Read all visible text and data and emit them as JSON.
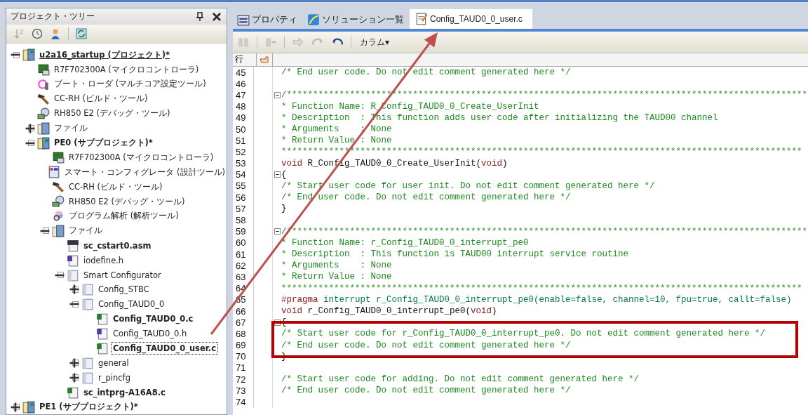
{
  "project_tree": {
    "title": "プロジェクト・ツリー",
    "items": [
      {
        "label": "u2a16_startup (プロジェクト)*",
        "kind": "project",
        "bold": true,
        "active": true,
        "selected": false,
        "expanded": true,
        "children": [
          {
            "label": "R7F702300A (マイクロコントローラ)",
            "kind": "chip",
            "bold": false,
            "selected": false
          },
          {
            "label": "ブート・ローダ (マルチコア設定ツール)",
            "kind": "boot",
            "bold": false,
            "selected": false
          },
          {
            "label": "CC-RH (ビルド・ツール)",
            "kind": "hammer",
            "bold": false,
            "selected": false
          },
          {
            "label": "RH850 E2 (デバッグ・ツール)",
            "kind": "debugger",
            "bold": false,
            "selected": false
          },
          {
            "label": "ファイル",
            "kind": "files",
            "bold": false,
            "selected": false,
            "expanded": false
          },
          {
            "label": "PE0 (サブプロジェクト)*",
            "kind": "project",
            "bold": true,
            "active": false,
            "selected": false,
            "expanded": true,
            "children": [
              {
                "label": "R7F702300A (マイクロコントローラ)",
                "kind": "chip",
                "bold": false,
                "selected": false
              },
              {
                "label": "スマート・コンフィグレータ (設計ツール)",
                "kind": "configurator",
                "bold": false,
                "selected": false
              },
              {
                "label": "CC-RH (ビルド・ツール)",
                "kind": "hammer",
                "bold": false,
                "selected": false
              },
              {
                "label": "RH850 E2 (デバッグ・ツール)",
                "kind": "debugger",
                "bold": false,
                "selected": false
              },
              {
                "label": "プログラム解析 (解析ツール)",
                "kind": "analyzer",
                "bold": false,
                "selected": false
              },
              {
                "label": "ファイル",
                "kind": "files",
                "bold": false,
                "selected": false,
                "expanded": true,
                "children": [
                  {
                    "label": "sc_cstart0.asm",
                    "kind": "asm",
                    "bold": true,
                    "selected": false
                  },
                  {
                    "label": "iodefine.h",
                    "kind": "h",
                    "bold": false,
                    "selected": false
                  },
                  {
                    "label": "Smart Configurator",
                    "kind": "folder",
                    "bold": false,
                    "selected": false,
                    "expanded": true,
                    "children": [
                      {
                        "label": "Config_STBC",
                        "kind": "folder",
                        "bold": false,
                        "selected": false,
                        "expanded": false
                      },
                      {
                        "label": "Config_TAUD0_0",
                        "kind": "folder",
                        "bold": false,
                        "selected": false,
                        "expanded": true,
                        "children": [
                          {
                            "label": "Config_TAUD0_0.c",
                            "kind": "c",
                            "bold": true,
                            "selected": false
                          },
                          {
                            "label": "Config_TAUD0_0.h",
                            "kind": "h",
                            "bold": false,
                            "selected": false
                          },
                          {
                            "label": "Config_TAUD0_0_user.c",
                            "kind": "c",
                            "bold": true,
                            "selected": true
                          }
                        ]
                      },
                      {
                        "label": "general",
                        "kind": "folder",
                        "bold": false,
                        "selected": false,
                        "expanded": false
                      },
                      {
                        "label": "r_pincfg",
                        "kind": "folder",
                        "bold": false,
                        "selected": false,
                        "expanded": false
                      }
                    ]
                  },
                  {
                    "label": "sc_intprg-A16A8.c",
                    "kind": "c",
                    "bold": true,
                    "selected": false
                  }
                ]
              }
            ]
          }
        ]
      },
      {
        "label": "PE1 (サブプロジェクト)*",
        "kind": "project",
        "bold": true,
        "active": false,
        "selected": false,
        "expanded": false
      }
    ]
  },
  "tabs": [
    {
      "label": "プロパティ",
      "kind": "properties",
      "selected": false
    },
    {
      "label": "ソリューション一覧",
      "kind": "solution",
      "selected": false
    },
    {
      "label": "Config_TAUD0_0_user.c",
      "kind": "document",
      "selected": true
    }
  ],
  "editor_toolbar": {
    "column_menu": "カラム▾"
  },
  "editor": {
    "line_header": "行",
    "lines": [
      {
        "number": "45",
        "fold": false,
        "segments": [
          {
            "kind": "comment",
            "text": "/* End user code. Do not edit comment generated here */"
          }
        ]
      },
      {
        "number": "46",
        "fold": false
      },
      {
        "number": "47",
        "fold": true,
        "segments": [
          {
            "kind": "comment",
            "text": "/***************************************************************************************************"
          }
        ]
      },
      {
        "number": "48",
        "fold": false,
        "segments": [
          {
            "kind": "comment",
            "text": "* Function Name: R_Config_TAUD0_0_Create_UserInit"
          }
        ]
      },
      {
        "number": "49",
        "fold": false,
        "segments": [
          {
            "kind": "comment",
            "text": "* Description  : This function adds user code after initializing the TAUD00 channel"
          }
        ]
      },
      {
        "number": "50",
        "fold": false,
        "segments": [
          {
            "kind": "comment",
            "text": "* Arguments    : None"
          }
        ]
      },
      {
        "number": "51",
        "fold": false,
        "segments": [
          {
            "kind": "comment",
            "text": "* Return Value : None"
          }
        ]
      },
      {
        "number": "52",
        "fold": false,
        "segments": [
          {
            "kind": "comment",
            "text": "***************************************************************************************************"
          }
        ]
      },
      {
        "number": "53",
        "fold": false,
        "segments": [
          {
            "kind": "keyword",
            "text": "void"
          },
          {
            "kind": "plain",
            "text": " R_Config_TAUD0_0_Create_UserInit("
          },
          {
            "kind": "keyword",
            "text": "void"
          },
          {
            "kind": "plain",
            "text": ")"
          }
        ]
      },
      {
        "number": "54",
        "fold": true,
        "segments": [
          {
            "kind": "plain",
            "text": "{"
          }
        ]
      },
      {
        "number": "55",
        "fold": false,
        "segments": [
          {
            "kind": "comment",
            "text": "/* Start user code for user init. Do not edit comment generated here */"
          }
        ]
      },
      {
        "number": "56",
        "fold": false,
        "segments": [
          {
            "kind": "comment",
            "text": "/* End user code. Do not edit comment generated here */"
          }
        ]
      },
      {
        "number": "57",
        "fold": false,
        "segments": [
          {
            "kind": "plain",
            "text": "}"
          }
        ]
      },
      {
        "number": "58",
        "fold": false
      },
      {
        "number": "59",
        "fold": true,
        "segments": [
          {
            "kind": "comment",
            "text": "/***************************************************************************************************"
          }
        ]
      },
      {
        "number": "60",
        "fold": false,
        "segments": [
          {
            "kind": "comment",
            "text": "* Function Name: r_Config_TAUD0_0_interrupt_pe0"
          }
        ]
      },
      {
        "number": "61",
        "fold": false,
        "segments": [
          {
            "kind": "comment",
            "text": "* Description  : This function is TAUD00 interrupt service routine"
          }
        ]
      },
      {
        "number": "62",
        "fold": false,
        "segments": [
          {
            "kind": "comment",
            "text": "* Arguments    : None"
          }
        ]
      },
      {
        "number": "63",
        "fold": false,
        "segments": [
          {
            "kind": "comment",
            "text": "* Return Value : None"
          }
        ]
      },
      {
        "number": "64",
        "fold": false,
        "segments": [
          {
            "kind": "comment",
            "text": "***************************************************************************************************"
          }
        ]
      },
      {
        "number": "65",
        "fold": false,
        "segments": [
          {
            "kind": "keyword",
            "text": "#pragma"
          },
          {
            "kind": "directive",
            "text": " interrupt r_Config_TAUD0_0_interrupt_pe0(enable=false, channel=10, fpu=true, callt=false)"
          }
        ]
      },
      {
        "number": "66",
        "fold": false,
        "segments": [
          {
            "kind": "keyword",
            "text": "void"
          },
          {
            "kind": "plain",
            "text": " r_Config_TAUD0_0_interrupt_pe0("
          },
          {
            "kind": "keyword",
            "text": "void"
          },
          {
            "kind": "plain",
            "text": ")"
          }
        ]
      },
      {
        "number": "67",
        "fold": true,
        "segments": [
          {
            "kind": "plain",
            "text": "{"
          }
        ]
      },
      {
        "number": "68",
        "fold": false,
        "segments": [
          {
            "kind": "comment",
            "text": "/* Start user code for r_Config_TAUD0_0_interrupt_pe0. Do not edit comment generated here */"
          }
        ]
      },
      {
        "number": "69",
        "fold": false,
        "segments": [
          {
            "kind": "comment",
            "text": "/* End user code. Do not edit comment generated here */"
          }
        ]
      },
      {
        "number": "70",
        "fold": false,
        "segments": [
          {
            "kind": "plain",
            "text": "}"
          }
        ]
      },
      {
        "number": "71",
        "fold": false
      },
      {
        "number": "72",
        "fold": false,
        "segments": [
          {
            "kind": "comment",
            "text": "/* Start user code for adding. Do not edit comment generated here */"
          }
        ]
      },
      {
        "number": "73",
        "fold": false,
        "segments": [
          {
            "kind": "comment",
            "text": "/* End user code. Do not edit comment generated here */"
          }
        ]
      },
      {
        "number": "74",
        "fold": false
      }
    ]
  }
}
